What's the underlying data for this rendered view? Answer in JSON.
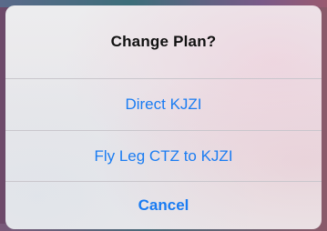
{
  "alert": {
    "title": "Change Plan?",
    "actions": [
      {
        "label": "Direct KJZI"
      },
      {
        "label": "Fly Leg CTZ to KJZI"
      }
    ],
    "cancel_label": "Cancel"
  },
  "colors": {
    "accent": "#1a7cf2",
    "title_text": "#111111",
    "divider": "#c9c6cc"
  }
}
